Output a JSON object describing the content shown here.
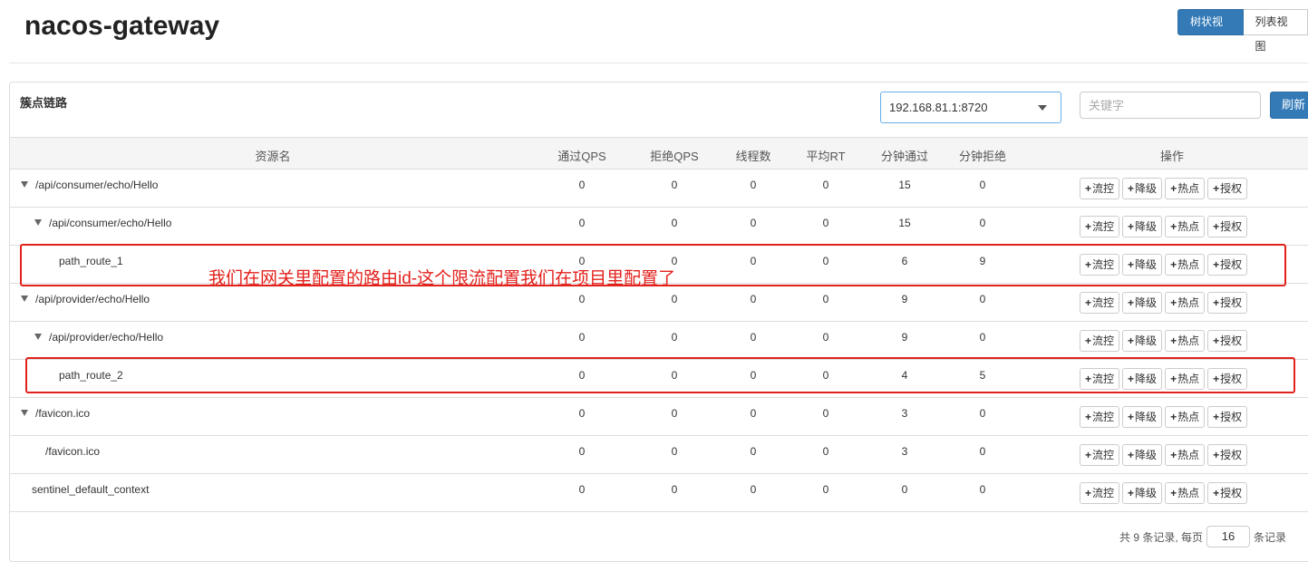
{
  "app": {
    "title": "nacos-gateway"
  },
  "view_toggle": {
    "tree_label": "树状视图",
    "list_label": "列表视图"
  },
  "panel": {
    "heading": "簇点链路",
    "machine": "192.168.81.1:8720",
    "search_placeholder": "关键字",
    "refresh_label": "刷新"
  },
  "columns": [
    "资源名",
    "通过QPS",
    "拒绝QPS",
    "线程数",
    "平均RT",
    "分钟通过",
    "分钟拒绝",
    "操作"
  ],
  "op_buttons": [
    "流控",
    "降级",
    "热点",
    "授权"
  ],
  "rows": [
    {
      "name": "/api/consumer/echo/Hello",
      "expanded": true,
      "values": [
        "0",
        "0",
        "0",
        "0",
        "15",
        "0"
      ]
    },
    {
      "name": "/api/consumer/echo/Hello",
      "expanded": true,
      "values": [
        "0",
        "0",
        "0",
        "0",
        "15",
        "0"
      ]
    },
    {
      "name": "path_route_1",
      "expanded": false,
      "values": [
        "0",
        "0",
        "0",
        "0",
        "6",
        "9"
      ]
    },
    {
      "name": "/api/provider/echo/Hello",
      "expanded": true,
      "values": [
        "0",
        "0",
        "0",
        "0",
        "9",
        "0"
      ]
    },
    {
      "name": "/api/provider/echo/Hello",
      "expanded": true,
      "values": [
        "0",
        "0",
        "0",
        "0",
        "9",
        "0"
      ]
    },
    {
      "name": "path_route_2",
      "expanded": false,
      "values": [
        "0",
        "0",
        "0",
        "0",
        "4",
        "5"
      ]
    },
    {
      "name": "/favicon.ico",
      "expanded": true,
      "values": [
        "0",
        "0",
        "0",
        "0",
        "3",
        "0"
      ]
    },
    {
      "name": "/favicon.ico",
      "expanded": false,
      "values": [
        "0",
        "0",
        "0",
        "0",
        "3",
        "0"
      ]
    },
    {
      "name": "sentinel_default_context",
      "expanded": false,
      "values": [
        "0",
        "0",
        "0",
        "0",
        "0",
        "0"
      ]
    }
  ],
  "annotation": "我们在网关里配置的路由id-这个限流配置我们在项目里配置了",
  "pagination": {
    "summary": "共 9 条记录, 每页",
    "page_size": "16",
    "suffix": "条记录"
  },
  "colors": {
    "primary": "#337ab7",
    "highlight": "#e3211c"
  }
}
